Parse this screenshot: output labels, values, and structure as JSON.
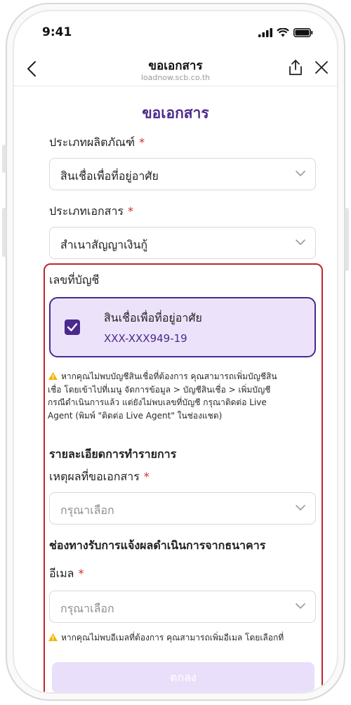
{
  "status_bar": {
    "time": "9:41"
  },
  "nav": {
    "title": "ขอเอกสาร",
    "url": "loadnow.scb.co.th"
  },
  "page": {
    "title": "ขอเอกสาร",
    "product_type": {
      "label": "ประเภทผลิตภัณฑ์",
      "required": "*",
      "value": "สินเชื่อเพื่อที่อยู่อาศัย"
    },
    "document_type": {
      "label": "ประเภทเอกสาร",
      "required": "*",
      "value": "สำเนาสัญญาเงินกู้"
    },
    "account": {
      "label": "เลขที่บัญชี",
      "name": "สินเชื่อเพื่อที่อยู่อาศัย",
      "number": "XXX-XXX949-19",
      "checked": true
    },
    "account_note_lines": [
      "หากคุณไม่พบบัญชีสินเชื่อที่ต้องการ คุณสามารถเพิ่มบัญชีสิน",
      "เชื่อ โดยเข้าไปที่เมนู จัดการข้อมูล > บัญชีสินเชื่อ > เพิ่มบัญชี",
      "กรณีดำเนินการแล้ว แต่ยังไม่พบเลขที่บัญชี กรุณาติดต่อ Live",
      "Agent (พิมพ์ \"ติดต่อ Live Agent\" ในช่องแชต)"
    ],
    "transaction_heading": "รายละเอียดการทำรายการ",
    "reason": {
      "label": "เหตุผลที่ขอเอกสาร",
      "required": "*",
      "placeholder": "กรุณาเลือก"
    },
    "channel_heading": "ช่องทางรับการแจ้งผลดำเนินการจากธนาคาร",
    "email": {
      "label": "อีเมล",
      "required": "*",
      "placeholder": "กรุณาเลือก"
    },
    "email_note": "หากคุณไม่พบอีเมลที่ต้องการ คุณสามารถเพิ่มอีเมล โดยเลือกที่",
    "submit_label": "ตกลง"
  },
  "colors": {
    "brand_purple": "#4a2a8c",
    "highlight_red": "#c0262d",
    "card_bg": "#ece3fa",
    "warning": "#f2b400"
  }
}
